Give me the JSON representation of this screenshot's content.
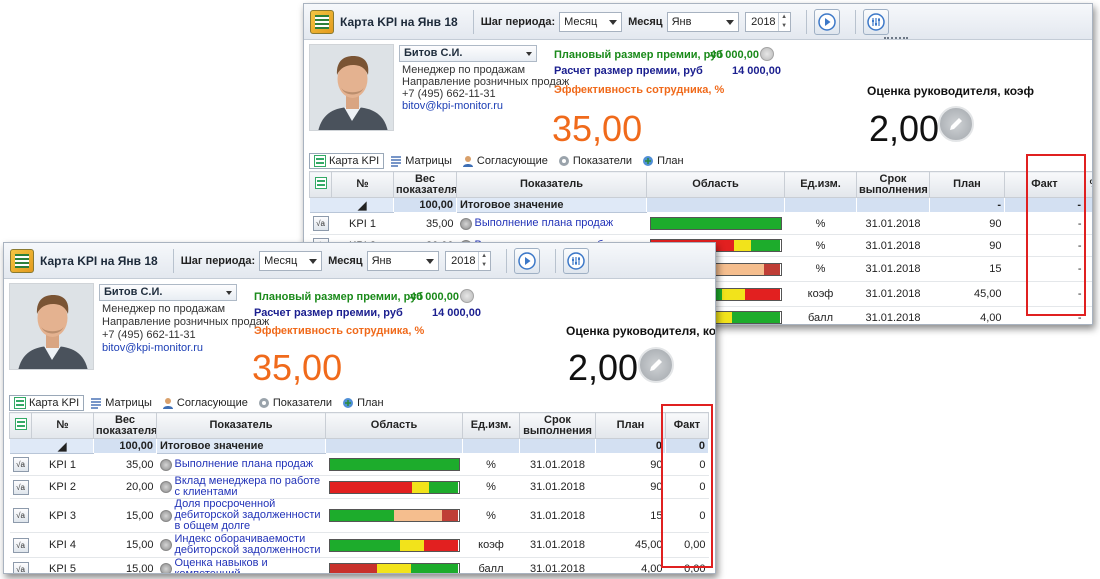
{
  "app": {
    "title": "Карта KPI на Янв 18",
    "period_step_label": "Шаг периода:",
    "period_step_value": "Месяц",
    "month_label": "Месяц",
    "month_value": "Янв",
    "year_value": "2018"
  },
  "employee": {
    "name": "Битов С.И.",
    "position": "Менеджер по продажам",
    "department": "Направление розничных продаж",
    "phone": "+7 (495) 662-11-31",
    "email": "bitov@kpi-monitor.ru"
  },
  "bonus": {
    "planned_label": "Плановый размер премии, руб",
    "planned_value": "40 000,00",
    "calc_label": "Расчет размер премии, руб",
    "calc_value": "14 000,00",
    "efficiency_label": "Эффективность сотрудника, %",
    "efficiency_value": "35,00",
    "manager_label": "Оценка руководителя, коэф",
    "manager_value": "2,00"
  },
  "tabs": [
    {
      "label": "Карта KPI",
      "icon": "kpi-card-icon"
    },
    {
      "label": "Матрицы",
      "icon": "matrix-icon"
    },
    {
      "label": "Согласующие",
      "icon": "approvers-icon"
    },
    {
      "label": "Показатели",
      "icon": "indicators-icon"
    },
    {
      "label": "План",
      "icon": "plan-icon"
    }
  ],
  "columns": {
    "num": "№",
    "weight": "Вес показателя",
    "indicator": "Показатель",
    "area": "Область",
    "unit": "Ед.изм.",
    "due": "Срок выполнения",
    "plan": "План",
    "fact": "Факт",
    "percent": "%"
  },
  "total_row": {
    "weight": "100,00",
    "label": "Итоговое значение",
    "plan": "0",
    "fact": "0",
    "back_plan": "-",
    "back_fact": "-"
  },
  "rows": [
    {
      "num": "KPI 1",
      "weight": "35,00",
      "name": "Выполнение плана продаж",
      "unit": "%",
      "due": "31.01.2018",
      "plan": "90",
      "fact": "0",
      "back_fact": "-",
      "bands": [
        {
          "color": "#d8272b",
          "share": 0
        },
        {
          "color": "#f2e31b",
          "share": 0
        },
        {
          "color": "#1dac2c",
          "share": 1
        }
      ]
    },
    {
      "num": "KPI 2",
      "weight": "20,00",
      "name": "Вклад менеджера по работе с клиентами",
      "back_name": "Вклад менеджера по работе с",
      "unit": "%",
      "due": "31.01.2018",
      "plan": "90",
      "fact": "0",
      "back_fact": "-",
      "bands": [
        {
          "color": "#e22020",
          "share": 0.64
        },
        {
          "color": "#f2e31b",
          "share": 0.13
        },
        {
          "color": "#1dac2c",
          "share": 0.23
        }
      ]
    },
    {
      "num": "KPI 3",
      "weight": "15,00",
      "name": "Доля просроченной дебиторской задолженности в общем долге",
      "unit": "%",
      "due": "31.01.2018",
      "plan": "15",
      "fact": "0",
      "back_fact": "-",
      "bands": [
        {
          "color": "#1dac2c",
          "share": 0.5
        },
        {
          "color": "#f5be8e",
          "share": 0.37
        },
        {
          "color": "#bf3e36",
          "share": 0.13
        }
      ]
    },
    {
      "num": "KPI 4",
      "weight": "15,00",
      "name": "Индекс оборачиваемости дебиторской задолженности",
      "unit": "коэф",
      "due": "31.01.2018",
      "plan": "45,00",
      "fact": "0,00",
      "back_fact": "-",
      "bands": [
        {
          "color": "#1dac2c",
          "share": 0.55
        },
        {
          "color": "#f2e31b",
          "share": 0.18
        },
        {
          "color": "#e22020",
          "share": 0.27
        }
      ]
    },
    {
      "num": "KPI 5",
      "weight": "15,00",
      "name": "Оценка навыков и компетенций",
      "unit": "балл",
      "due": "31.01.2018",
      "plan": "4,00",
      "fact": "0,00",
      "back_fact": "-",
      "bands": [
        {
          "color": "#c8312c",
          "share": 0.37
        },
        {
          "color": "#f2e31b",
          "share": 0.26
        },
        {
          "color": "#1dac2c",
          "share": 0.37
        }
      ]
    }
  ],
  "colors": {
    "efficiency": "#f06a1b",
    "planned_bonus": "#1a8a1a",
    "calc_bonus": "#1b1f8f",
    "highlight": "#e02020",
    "link": "#2233b8"
  }
}
